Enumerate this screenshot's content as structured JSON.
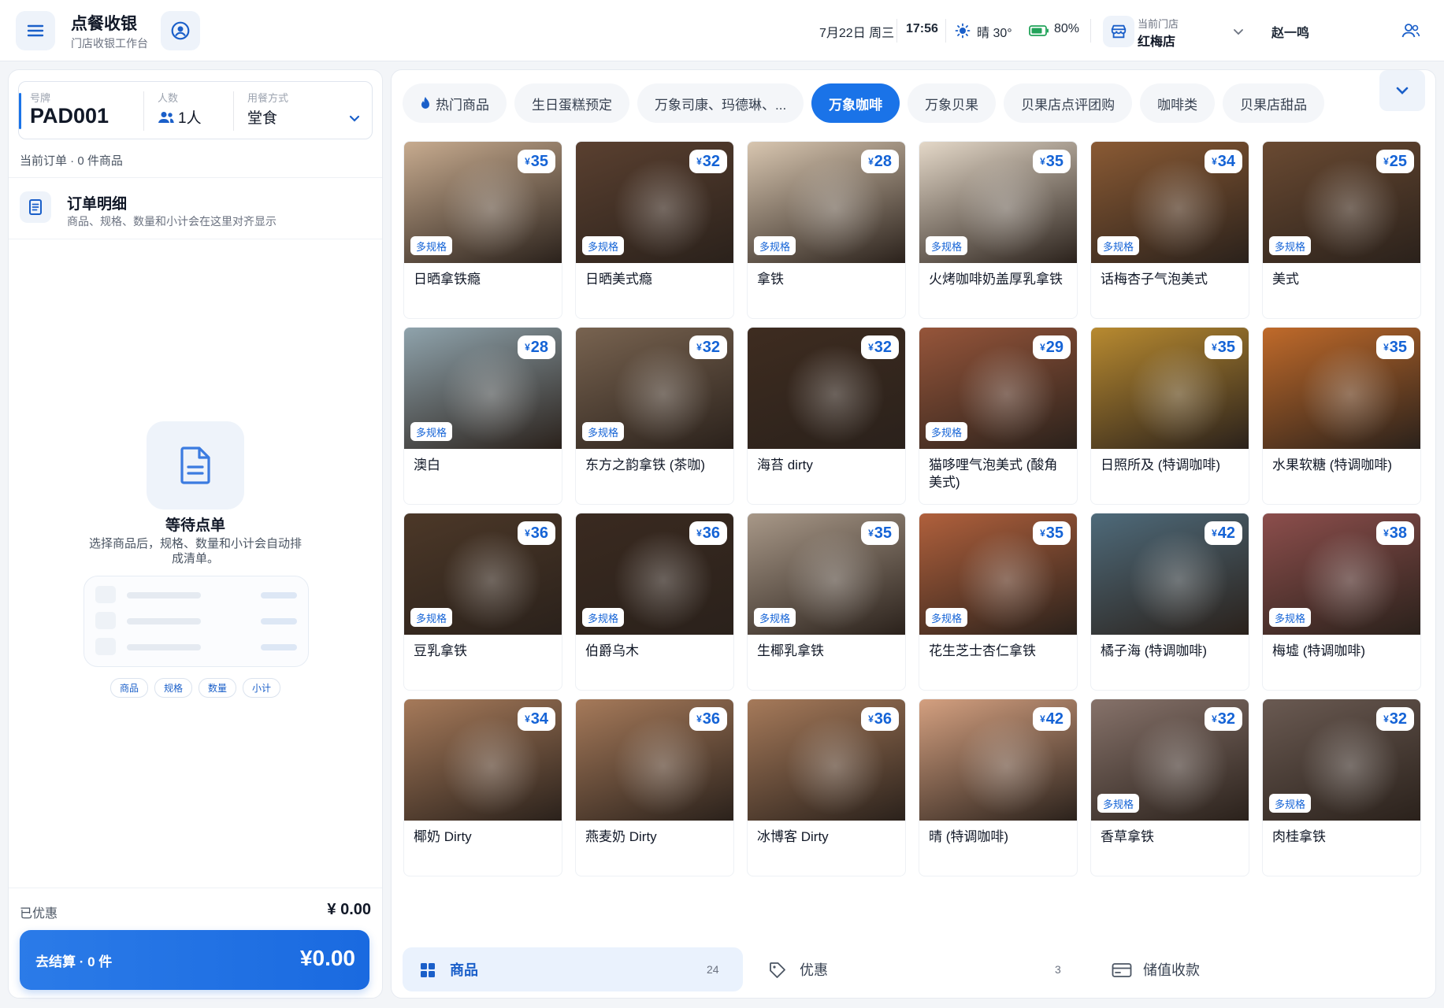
{
  "header": {
    "title": "点餐收银",
    "subtitle": "门店收银工作台",
    "date": "7月22日 周三",
    "time": "17:56",
    "weather": "晴 30°",
    "battery": "80%",
    "store_label": "当前门店",
    "store_name": "红梅店",
    "user": "赵一鸣"
  },
  "order": {
    "plate_label": "号牌",
    "plate_value": "PAD001",
    "people_label": "人数",
    "people_value": "1人",
    "mode_label": "用餐方式",
    "mode_value": "堂食",
    "current": "当前订单 · 0 件商品",
    "detail_title": "订单明细",
    "detail_sub": "商品、规格、数量和小计会在这里对齐显示",
    "empty_title": "等待点单",
    "empty_desc_1": "选择商品后，规格、数量和小计会自动排",
    "empty_desc_2": "成清单。",
    "chips": [
      "商品",
      "规格",
      "数量",
      "小计"
    ],
    "discount_label": "已优惠",
    "discount_value": "¥ 0.00",
    "checkout_label": "去结算 · 0 件",
    "checkout_total": "¥0.00"
  },
  "tabs": [
    {
      "label": "热门商品"
    },
    {
      "label": "生日蛋糕预定"
    },
    {
      "label": "万象司康、玛德琳、..."
    },
    {
      "label": "万象咖啡"
    },
    {
      "label": "万象贝果"
    },
    {
      "label": "贝果店点评团购"
    },
    {
      "label": "咖啡类"
    },
    {
      "label": "贝果店甜品"
    }
  ],
  "active_tab": "万象咖啡",
  "products": [
    {
      "name": "日晒拿铁瘾",
      "price": "35",
      "spec": "多规格",
      "bg": "#c7ab8f"
    },
    {
      "name": "日晒美式瘾",
      "price": "32",
      "spec": "多规格",
      "bg": "#5a4030"
    },
    {
      "name": "拿铁",
      "price": "28",
      "spec": "多规格",
      "bg": "#d8c6b0"
    },
    {
      "name": "火烤咖啡奶盖厚乳拿铁",
      "price": "35",
      "spec": "多规格",
      "bg": "#e4d8c8"
    },
    {
      "name": "话梅杏子气泡美式",
      "price": "34",
      "spec": "多规格",
      "bg": "#8a5a34"
    },
    {
      "name": "美式",
      "price": "25",
      "spec": "多规格",
      "bg": "#6a4a32"
    },
    {
      "name": "澳白",
      "price": "28",
      "spec": "多规格",
      "bg": "#8fa3ac"
    },
    {
      "name": "东方之韵拿铁 (茶咖)",
      "price": "32",
      "spec": "多规格",
      "bg": "#786350"
    },
    {
      "name": "海苔 dirty",
      "price": "32",
      "spec": "",
      "bg": "#3e2c20"
    },
    {
      "name": "猫哆哩气泡美式 (酸角美式)",
      "price": "29",
      "spec": "多规格",
      "bg": "#96553a"
    },
    {
      "name": "日照所及 (特调咖啡)",
      "price": "35",
      "spec": "",
      "bg": "#b88a30"
    },
    {
      "name": "水果软糖 (特调咖啡)",
      "price": "35",
      "spec": "",
      "bg": "#c06a2a"
    },
    {
      "name": "豆乳拿铁",
      "price": "36",
      "spec": "多规格",
      "bg": "#4c3828"
    },
    {
      "name": "伯爵乌木",
      "price": "36",
      "spec": "多规格",
      "bg": "#3a2a20"
    },
    {
      "name": "生椰乳拿铁",
      "price": "35",
      "spec": "多规格",
      "bg": "#a89888"
    },
    {
      "name": "花生芝士杏仁拿铁",
      "price": "35",
      "spec": "多规格",
      "bg": "#b0603c"
    },
    {
      "name": "橘子海 (特调咖啡)",
      "price": "42",
      "spec": "",
      "bg": "#4e6a7a"
    },
    {
      "name": "梅墟 (特调咖啡)",
      "price": "38",
      "spec": "多规格",
      "bg": "#8c4e4c"
    },
    {
      "name": "椰奶 Dirty",
      "price": "34",
      "spec": "",
      "bg": "#a67a5a"
    },
    {
      "name": "燕麦奶 Dirty",
      "price": "36",
      "spec": "",
      "bg": "#a67a5a"
    },
    {
      "name": "冰博客 Dirty",
      "price": "36",
      "spec": "",
      "bg": "#a67a5a"
    },
    {
      "name": "晴 (特调咖啡)",
      "price": "42",
      "spec": "",
      "bg": "#d4a080"
    },
    {
      "name": "香草拿铁",
      "price": "32",
      "spec": "多规格",
      "bg": "#86726a"
    },
    {
      "name": "肉桂拿铁",
      "price": "32",
      "spec": "多规格",
      "bg": "#6a5a52"
    }
  ],
  "bottom": {
    "goods_label": "商品",
    "goods_count": "24",
    "promo_label": "优惠",
    "promo_count": "3",
    "stored_label": "储值收款"
  },
  "colors": {
    "accent": "#1a73e8",
    "price": "#1463d6"
  }
}
